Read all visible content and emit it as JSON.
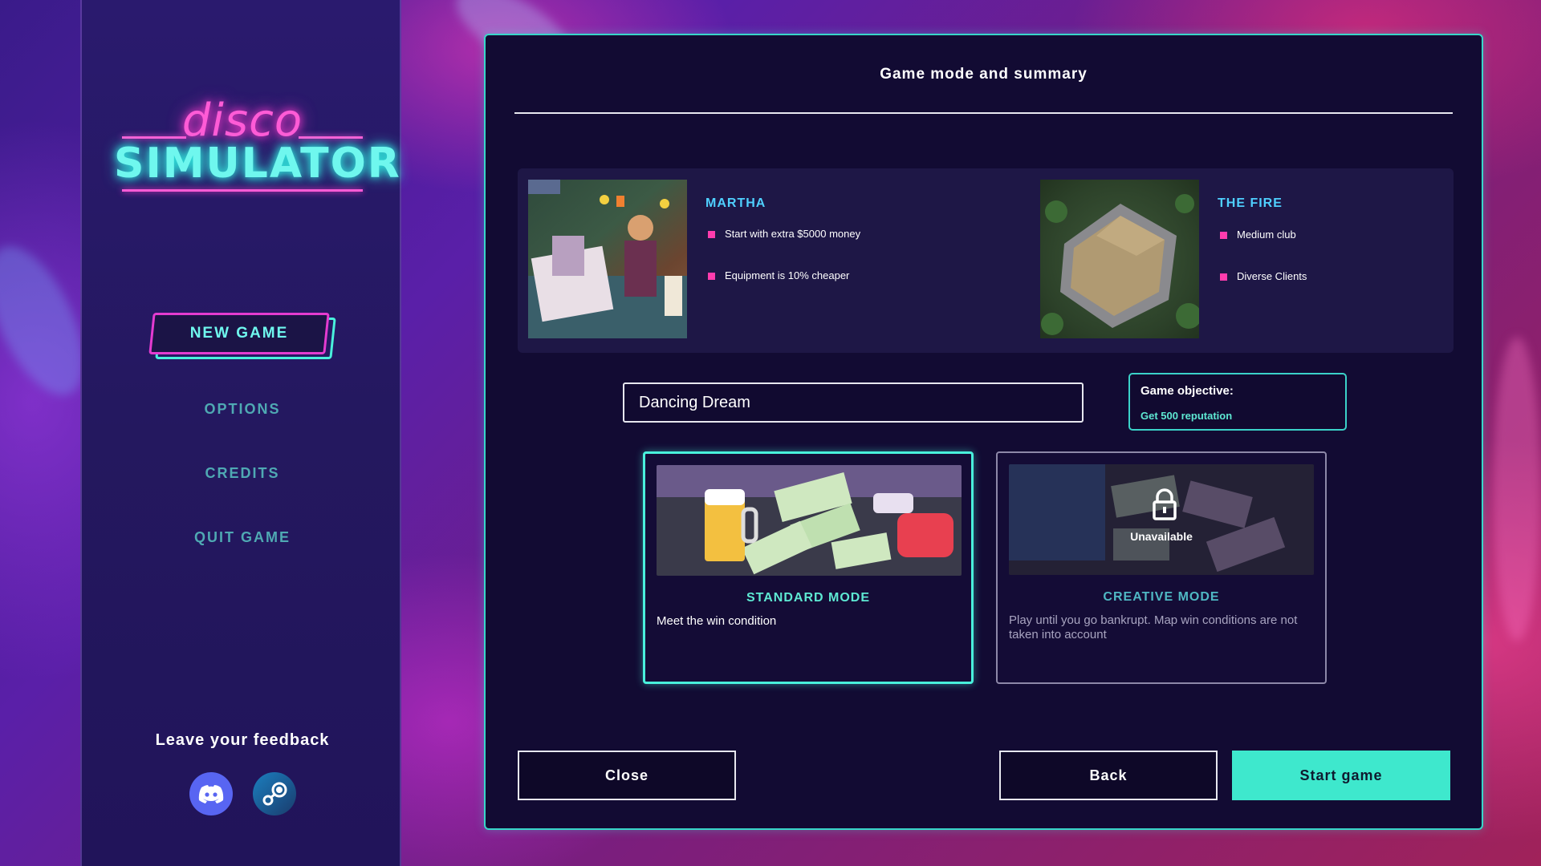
{
  "logo": {
    "line1": "disco",
    "line2": "SIMULATOR"
  },
  "menu": {
    "new_game": "NEW GAME",
    "options": "OPTIONS",
    "credits": "CREDITS",
    "quit_game": "QUIT GAME"
  },
  "feedback": {
    "title": "Leave your feedback",
    "icons": [
      "discord-icon",
      "steam-icon"
    ]
  },
  "panel": {
    "title": "Game mode and summary",
    "character": {
      "name": "MARTHA",
      "perks": [
        "Start with extra $5000 money",
        "Equipment is 10% cheaper"
      ]
    },
    "club": {
      "name": "THE FIRE",
      "perks": [
        "Medium club",
        "Diverse Clients"
      ]
    },
    "club_name_value": "Dancing Dream",
    "objective": {
      "label": "Game objective:",
      "value": "Get 500 reputation"
    },
    "modes": [
      {
        "title": "STANDARD MODE",
        "description": "Meet the win condition",
        "selected": true,
        "locked": false
      },
      {
        "title": "CREATIVE MODE",
        "description": "Play until you go bankrupt. Map win conditions are not taken into account",
        "selected": false,
        "locked": true,
        "lock_label": "Unavailable"
      }
    ],
    "buttons": {
      "close": "Close",
      "back": "Back",
      "start": "Start game"
    }
  },
  "colors": {
    "accent_cyan": "#3ee8cd",
    "accent_pink": "#ff3cae",
    "panel_bg": "#120b33",
    "sidebar_bg": "#24185f",
    "link_blue": "#4fd0ff"
  }
}
